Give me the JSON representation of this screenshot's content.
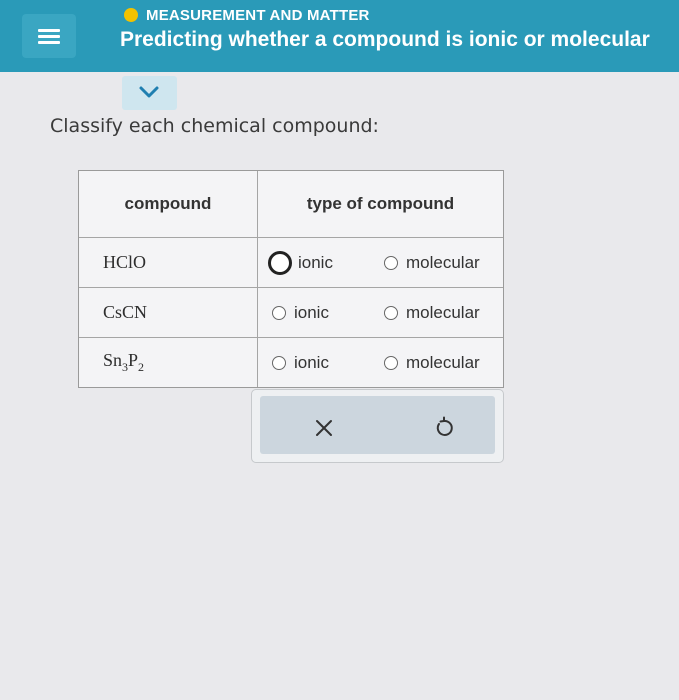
{
  "header": {
    "category": "MEASUREMENT AND MATTER",
    "title": "Predicting whether a compound is ionic or molecular",
    "status_color": "#f2c200",
    "bar_color": "#2a9ab8"
  },
  "question": {
    "prompt": "Classify each chemical compound:"
  },
  "table": {
    "headers": [
      "compound",
      "type of compound"
    ],
    "rows": [
      {
        "formula": [
          {
            "t": "HClO"
          }
        ],
        "options": [
          "ionic",
          "molecular"
        ],
        "selected": null
      },
      {
        "formula": [
          {
            "t": "CsCN"
          }
        ],
        "options": [
          "ionic",
          "molecular"
        ],
        "selected": null
      },
      {
        "formula": [
          {
            "t": "Sn"
          },
          {
            "sub": "3"
          },
          {
            "t": "P"
          },
          {
            "sub": "2"
          }
        ],
        "options": [
          "ionic",
          "molecular"
        ],
        "selected": null
      }
    ]
  },
  "actions": {
    "clear_icon": "x-icon",
    "undo_icon": "undo-icon"
  }
}
